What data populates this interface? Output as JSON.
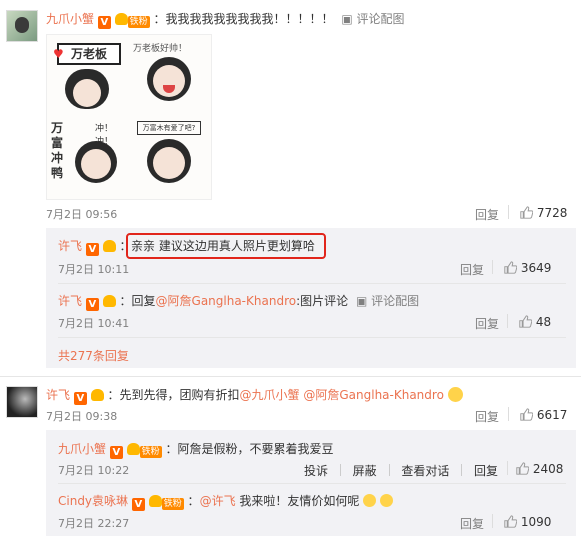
{
  "c1": {
    "user": "九爪小蟹",
    "fan_badge": "铁粉",
    "text": "：我我我我我我我我我！！！！！",
    "pic_comment": "评论配图",
    "sticker_captions": [
      "万老板",
      "万老板好帅！",
      "万富冲鸭",
      "冲！冲！",
      "万富木有爱了吧?"
    ],
    "time": "7月2日 09:56",
    "reply": "回复",
    "likes": "7728"
  },
  "r1": {
    "user": "许飞",
    "text": "亲亲 建议这边用真人照片更划算哈",
    "time": "7月2日 10:11",
    "reply": "回复",
    "likes": "3649"
  },
  "r2": {
    "user": "许飞",
    "prefix": "：回复",
    "mention": "@阿詹Ganglha-Khandro",
    "suffix": ":图片评论",
    "pic_comment": "评论配图",
    "time": "7月2日 10:41",
    "reply": "回复",
    "likes": "48"
  },
  "more_replies": "共277条回复",
  "c2": {
    "user": "许飞",
    "text1": "：先到先得，团购有折扣",
    "mention1": "@九爪小蟹",
    "mention2": "@阿詹Ganglha-Khandro",
    "time": "7月2日 09:38",
    "reply": "回复",
    "likes": "6617"
  },
  "r3": {
    "user": "九爪小蟹",
    "fan_badge": "铁粉",
    "text": "：阿詹是假粉，不要累着我爱豆",
    "time": "7月2日 10:22",
    "report": "投诉",
    "block": "屏蔽",
    "view_conv": "查看对话",
    "reply": "回复",
    "likes": "2408"
  },
  "r4": {
    "user": "Cindy袁咏琳",
    "fan_badge": "铁粉",
    "mention": "@许飞",
    "text": " 我来啦！友情价如何呢",
    "time": "7月2日 22:27",
    "reply": "回复",
    "likes": "1090"
  },
  "colors": {
    "user": "#eb7350",
    "highlight": "#e1251b",
    "reply_bg": "#f2f2f5"
  }
}
